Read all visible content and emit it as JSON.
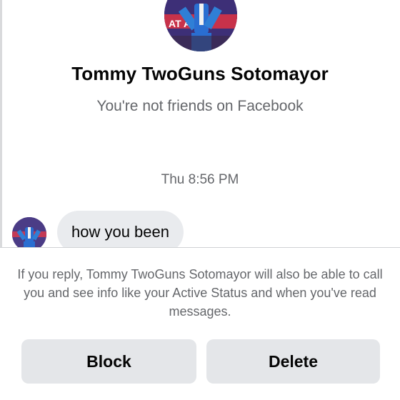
{
  "profile": {
    "name": "Tommy TwoGuns Sotomayor",
    "friend_status": "You're not friends on Facebook",
    "avatar_banner_text": "AT     A"
  },
  "conversation": {
    "timestamp": "Thu 8:56 PM",
    "messages": [
      {
        "sender": "Tommy TwoGuns Sotomayor",
        "text": "how you been"
      }
    ]
  },
  "footer": {
    "notice": "If you reply, Tommy TwoGuns Sotomayor will also be able to call you and see info like your Active Status and when you've read messages.",
    "block_label": "Block",
    "delete_label": "Delete"
  },
  "colors": {
    "primary_text": "#050505",
    "secondary_text": "#65676b",
    "bubble_bg": "#e9ebee",
    "button_bg": "#e4e6e9"
  }
}
